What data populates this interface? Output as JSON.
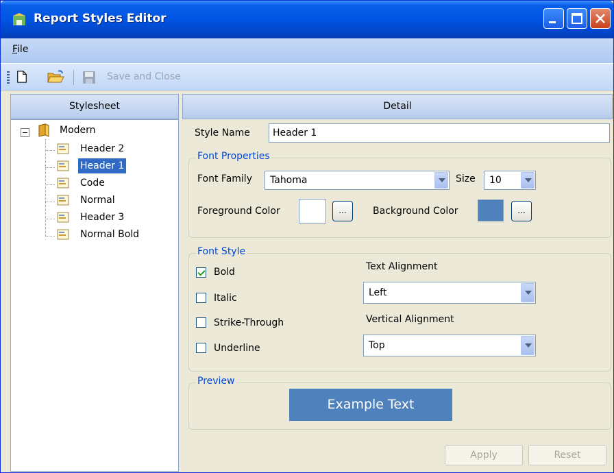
{
  "window": {
    "title": "Report Styles Editor"
  },
  "menu": {
    "file": "File"
  },
  "toolbar": {
    "save_close_label": "Save and Close"
  },
  "stylesheet_panel": {
    "header": "Stylesheet",
    "root": "Modern",
    "items": [
      "Header 2",
      "Header 1",
      "Code",
      "Normal",
      "Header 3",
      "Normal Bold"
    ],
    "selected": "Header 1"
  },
  "detail_panel": {
    "header": "Detail",
    "style_name_label": "Style Name",
    "style_name_value": "Header 1",
    "font_properties": {
      "title": "Font Properties",
      "font_family_label": "Font Family",
      "font_family_value": "Tahoma",
      "size_label": "Size",
      "size_value": "10",
      "foreground_label": "Foreground Color",
      "foreground_color": "#ffffff",
      "background_label": "Background Color",
      "background_color": "#4f81bd",
      "ellipsis": "..."
    },
    "font_style": {
      "title": "Font Style",
      "bold": {
        "label": "Bold",
        "checked": true
      },
      "italic": {
        "label": "Italic",
        "checked": false
      },
      "strike": {
        "label": "Strike-Through",
        "checked": false
      },
      "underline": {
        "label": "Underline",
        "checked": false
      },
      "text_alignment_label": "Text Alignment",
      "text_alignment_value": "Left",
      "vertical_alignment_label": "Vertical Alignment",
      "vertical_alignment_value": "Top"
    },
    "preview": {
      "title": "Preview",
      "text": "Example Text"
    },
    "buttons": {
      "apply": "Apply",
      "reset": "Reset"
    }
  }
}
